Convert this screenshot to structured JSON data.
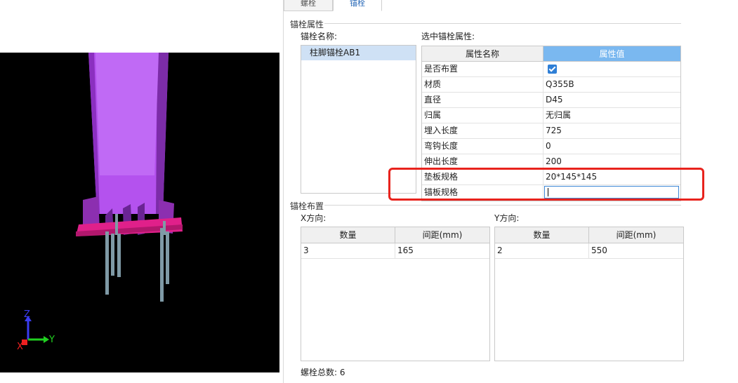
{
  "tabs": [
    {
      "label": "螺栓"
    },
    {
      "label": "锚栓"
    }
  ],
  "anchor_props": {
    "title": "锚栓属性",
    "name_label": "锚栓名称:",
    "names": [
      "柱脚锚栓AB1"
    ],
    "selected_label": "选中锚栓属性:",
    "grid_header": {
      "name": "属性名称",
      "value": "属性值"
    },
    "rows": [
      {
        "name": "是否布置",
        "value": "",
        "checked": true
      },
      {
        "name": "材质",
        "value": "Q355B"
      },
      {
        "name": "直径",
        "value": "D45"
      },
      {
        "name": "归属",
        "value": "无归属"
      },
      {
        "name": "埋入长度",
        "value": "725"
      },
      {
        "name": "弯钩长度",
        "value": "0"
      },
      {
        "name": "伸出长度",
        "value": "200"
      },
      {
        "name": "垫板规格",
        "value": "20*145*145"
      },
      {
        "name": "锚板规格",
        "value": ""
      }
    ]
  },
  "layout_section": {
    "title": "锚栓布置",
    "x_label": "X方向:",
    "y_label": "Y方向:",
    "x_table": {
      "headers": [
        "数量",
        "间距(mm)"
      ],
      "rows": [
        [
          "3",
          "165"
        ]
      ]
    },
    "y_table": {
      "headers": [
        "数量",
        "间距(mm)"
      ],
      "rows": [
        [
          "2",
          "550"
        ]
      ]
    },
    "total_label": "螺栓总数:",
    "total_value": "6"
  },
  "axis": {
    "z": "Z",
    "y": "Y",
    "x": "X"
  },
  "colors": {
    "column": "#b84ef0",
    "plate": "#e0208a",
    "viewport_bg": "#000000",
    "header_accent": "#7ab8f0",
    "highlight": "#e8231d"
  }
}
